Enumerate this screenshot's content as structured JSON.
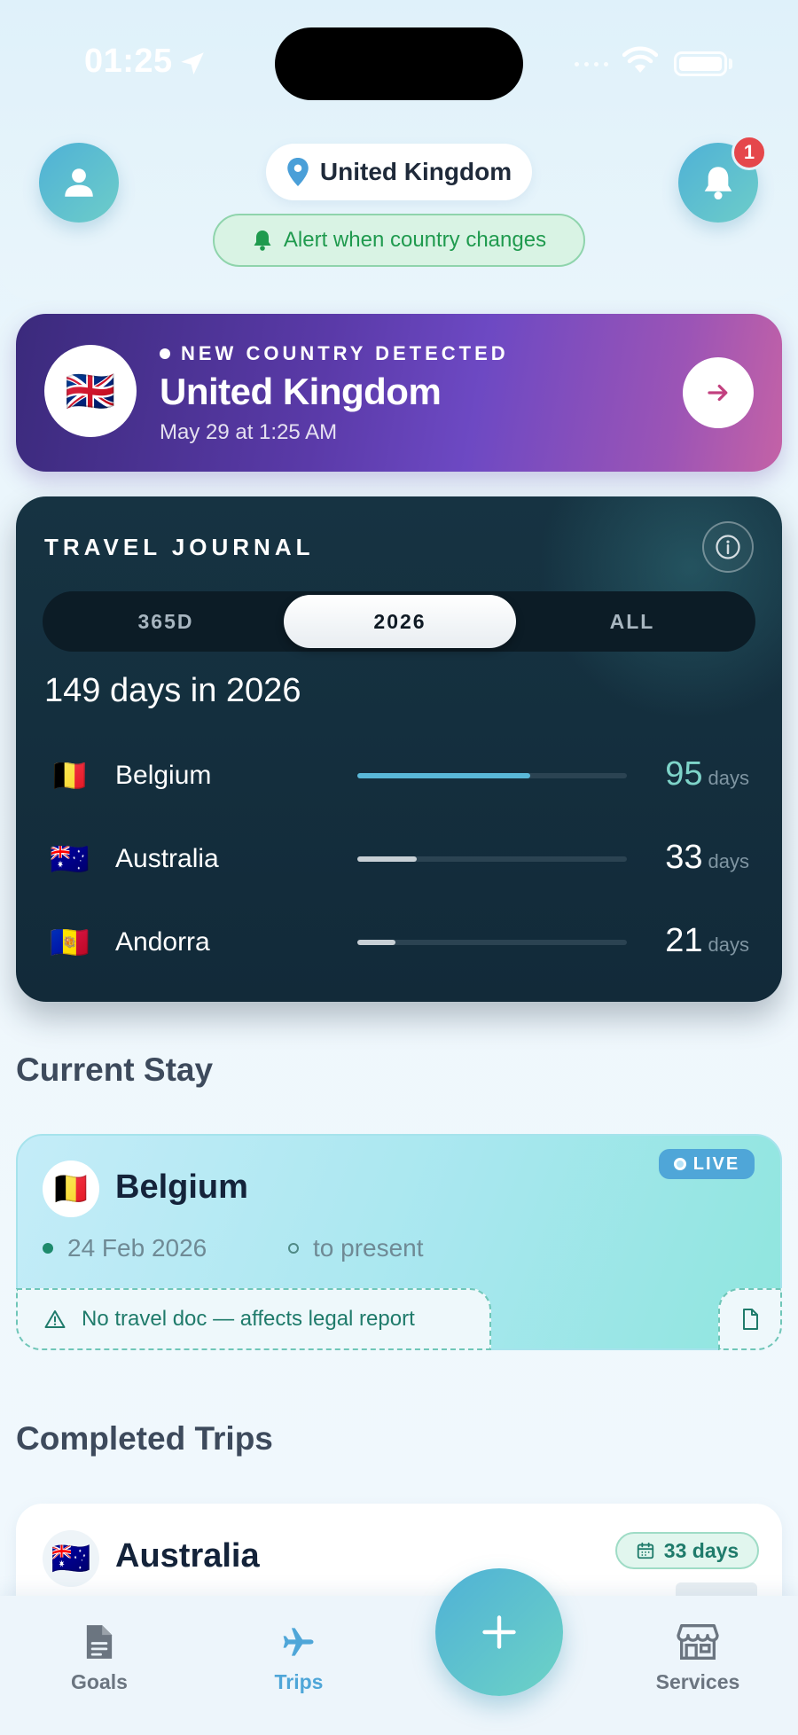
{
  "status_bar": {
    "time": "01:25"
  },
  "header": {
    "current_country": "United Kingdom",
    "alert_toggle_label": "Alert when country changes",
    "notification_count": "1"
  },
  "banner": {
    "eyebrow": "NEW COUNTRY DETECTED",
    "country": "United Kingdom",
    "flag": "🇬🇧",
    "detected_at": "May 29 at 1:25 AM"
  },
  "journal": {
    "title": "TRAVEL JOURNAL",
    "tabs": [
      "365D",
      "2026",
      "ALL"
    ],
    "active_tab": "2026",
    "summary": "149 days in 2026",
    "unit": "days",
    "rows": [
      {
        "flag": "🇧🇪",
        "country": "Belgium",
        "days": "95",
        "fraction": 0.64,
        "color": "#5ab8d8"
      },
      {
        "flag": "🇦🇺",
        "country": "Australia",
        "days": "33",
        "fraction": 0.22,
        "color": "#c7cfd5"
      },
      {
        "flag": "🇦🇩",
        "country": "Andorra",
        "days": "21",
        "fraction": 0.14,
        "color": "#c7cfd5"
      }
    ]
  },
  "current_stay": {
    "section_title": "Current Stay",
    "badge": "LIVE",
    "flag": "🇧🇪",
    "country": "Belgium",
    "start": "24 Feb 2026",
    "end": "to present",
    "warning": "No travel doc — affects legal report"
  },
  "completed": {
    "section_title": "Completed Trips",
    "trips": [
      {
        "flag": "🇦🇺",
        "country": "Australia",
        "days_badge": "33 days"
      }
    ]
  },
  "tabbar": {
    "items": [
      {
        "label": "Goals",
        "icon": "document-icon",
        "color": "#6b7580"
      },
      {
        "label": "Trips",
        "icon": "airplane-icon",
        "color": "#4fa6d8"
      },
      {
        "label": "Services",
        "icon": "storefront-icon",
        "color": "#6b7580"
      }
    ]
  }
}
